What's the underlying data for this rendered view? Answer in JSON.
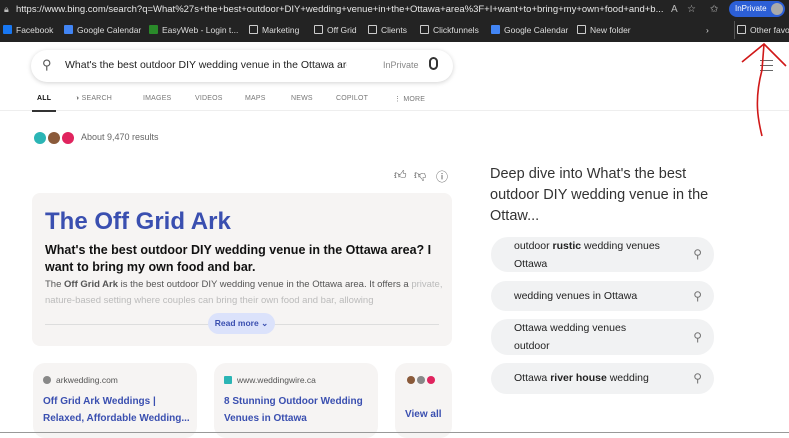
{
  "browser": {
    "url": "https://www.bing.com/search?q=What%27s+the+best+outdoor+DIY+wedding+venue+in+the+Ottawa+area%3F+I+want+to+bring+my+own+food+and+b...",
    "inprivate_label": "InPrivate",
    "bookmarks": [
      {
        "label": "Facebook",
        "icon": "facebook-icon",
        "color": "#1877f2"
      },
      {
        "label": "Google Calendar",
        "icon": "calendar-icon",
        "color": "#4285f4"
      },
      {
        "label": "EasyWeb - Login t...",
        "icon": "td-icon",
        "color": "#2a8a2a"
      },
      {
        "label": "Marketing",
        "icon": "folder-icon"
      },
      {
        "label": "Off Grid",
        "icon": "folder-icon"
      },
      {
        "label": "Clients",
        "icon": "folder-icon"
      },
      {
        "label": "Clickfunnels",
        "icon": "folder-icon"
      },
      {
        "label": "Google Calendar",
        "icon": "calendar-icon",
        "color": "#4285f4"
      },
      {
        "label": "New folder",
        "icon": "folder-icon"
      }
    ],
    "other_favorites": "Other favori"
  },
  "search": {
    "query": "What's the best outdoor DIY wedding venue in the Ottawa are:",
    "inprivate": "InPrivate"
  },
  "tabs": [
    "ALL",
    "SEARCH",
    "IMAGES",
    "VIDEOS",
    "MAPS",
    "NEWS",
    "COPILOT",
    "MORE"
  ],
  "results_count": "About 9,470 results",
  "answer": {
    "title": "The Off Grid Ark",
    "question": "What's the best outdoor DIY wedding venue in the Ottawa area? I want to bring my own food and bar.",
    "body_pre": "The ",
    "body_bold": "Off Grid Ark",
    "body_post": " is the best outdoor DIY wedding venue in the Ottawa area. It offers a",
    "body_fade": "private, nature-based setting where couples can bring their own food and bar, allowing",
    "read_more": "Read more ⌄"
  },
  "sources": [
    {
      "domain": "arkwedding.com",
      "title": "Off Grid Ark Weddings | Relaxed, Affordable Wedding..."
    },
    {
      "domain": "www.weddingwire.ca",
      "title": "8 Stunning Outdoor Wedding Venues in Ottawa"
    }
  ],
  "view_all": "View all",
  "deep_dive": "Deep dive into What's the best outdoor DIY wedding venue in the Ottaw...",
  "related": [
    {
      "pre": "outdoor ",
      "bold": "rustic",
      "post": " wedding venues Ottawa"
    },
    {
      "pre": "wedding venues in Ottawa",
      "bold": "",
      "post": ""
    },
    {
      "pre": "Ottawa wedding venues outdoor",
      "bold": "",
      "post": ""
    },
    {
      "pre": "Ottawa ",
      "bold": "river house",
      "post": " wedding"
    }
  ],
  "colors": {
    "accent": "#3a4fb0",
    "annotation": "#d01818"
  }
}
